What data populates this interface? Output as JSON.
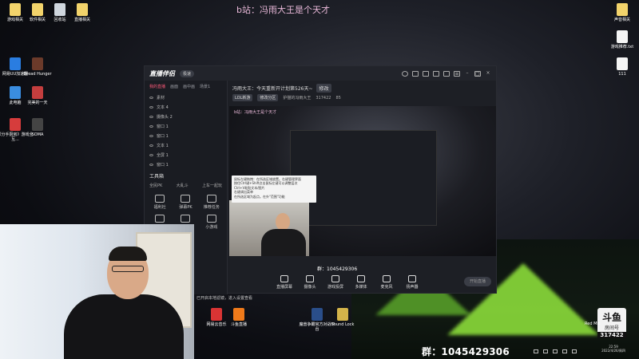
{
  "top_watermark": "b站：冯雨大王是个天才",
  "desktop_left": [
    {
      "label": "游戏相关",
      "color": "#f2d36b"
    },
    {
      "label": "软件相关",
      "color": "#f2d36b"
    },
    {
      "label": "回收站",
      "color": "#cfd6de"
    },
    {
      "label": "直播相关",
      "color": "#f2d36b"
    },
    {
      "label": "网易UU加速器",
      "color": "#2a7de1"
    },
    {
      "label": "Dread Hunger",
      "color": "#6b3a2a"
    },
    {
      "label": "此电脑",
      "color": "#3a8de0"
    },
    {
      "label": "完美的一天",
      "color": "#c43e3e"
    },
    {
      "label": "《分手厨房》游戏全互...",
      "color": "#d63c3c"
    },
    {
      "label": "SOMA",
      "color": "#444"
    }
  ],
  "desktop_right": [
    {
      "label": "声音相关",
      "color": "#f2d36b"
    },
    {
      "label": "游戏推荐.txt",
      "color": "#f4f4f4"
    },
    {
      "label": "111",
      "color": "#f4f4f4"
    }
  ],
  "desktop_bottom": [
    {
      "label": "网易云音乐",
      "color": "#d93434"
    },
    {
      "label": "斗鱼直播",
      "color": "#f07a1a"
    },
    {
      "label": "魔兽争霸官方对战平台",
      "color": "#2a4e8a"
    },
    {
      "label": "Sound Lock",
      "color": "#d4b44a"
    }
  ],
  "app": {
    "logo": "直播伴侣",
    "version_pill": "极速",
    "left_tabs": [
      "我的直播",
      "画面",
      "画中画",
      "场景1"
    ],
    "scenes": [
      "素材",
      "文本 4",
      "摄像头 2",
      "窗口 1",
      "窗口 1",
      "文本 1",
      "全屏 1",
      "窗口 1"
    ],
    "tools_title": "工具箱",
    "tool_row": [
      "全民PK",
      "大乱斗",
      "上车一起玩"
    ],
    "tools": [
      "福利社",
      "弹幕PK",
      "推荐任务",
      "",
      "发布任务",
      "小游戏"
    ],
    "room_title": "冯雨大王：今天重新开计划第526天~",
    "room_title_btn": "修改",
    "room_sub_tag": "LOL新游",
    "room_sub_tag2": "修改分区",
    "room_name": "护猫的冯雨大王",
    "room_id": "317422",
    "heat": "85",
    "preview_caption": "b站：冯雨大王是个天才",
    "tooltip": "鼠标左键拖拽：在所选区域放置。右键管理界面\n按住Ctrl键+Shift点击鼠标左键可以调整层次\nCtrl+V粘贴文本/图片\n右键调出菜单\n在所选区域为起点。在外\"范围\"功能",
    "qq_group_in_window": "群：1045429306",
    "bottom_tools": [
      "直播屏幕",
      "摄像头",
      "游戏投屏",
      "多媒体",
      "麦克风",
      "扬声器"
    ],
    "start_btn": "开始直播",
    "status": "已开启本地滤镜，进入设置查看"
  },
  "qq_group": "群：1045429306",
  "badge": {
    "top": "斗鱼",
    "label": "房间号",
    "num": "317422"
  },
  "clock": {
    "time": "22:59",
    "date": "2022/4/26/周四"
  },
  "red_mic_label": "Red Mic"
}
